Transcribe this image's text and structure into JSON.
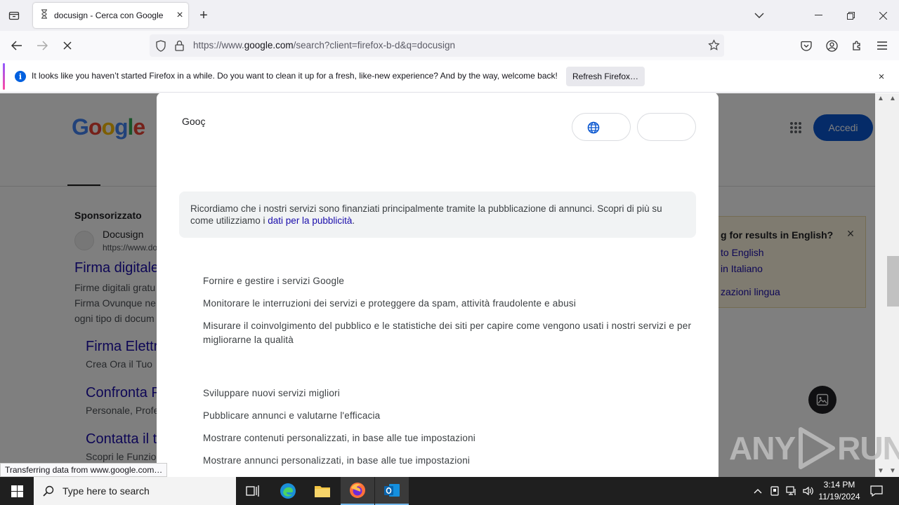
{
  "browser": {
    "tab_title": "docusign - Cerca con Google",
    "url_prefix": "https://www.",
    "url_domain": "google.com",
    "url_path": "/search?client=firefox-b-d&q=docusign"
  },
  "infobar": {
    "message": "It looks like you haven’t started Firefox in a while. Do you want to clean it up for a fresh, like-new experience? And by the way, welcome back!",
    "button": "Refresh Firefox…"
  },
  "google": {
    "signin": "Accedi",
    "sponsored": "Sponsorizzato",
    "ad_name": "Docusign",
    "ad_url": "https://www.do",
    "ad_title": "Firma digitale",
    "ad_desc": [
      "Firme digitali gratu",
      "Firma Ovunque ne",
      "ogni tipo di docum"
    ],
    "sitelinks": [
      {
        "title": "Firma Elettr",
        "desc": "Crea Ora il Tuo"
      },
      {
        "title": "Confronta P",
        "desc": "Personale, Profe"
      },
      {
        "title": "Contatta il t",
        "desc": "Scopri le Funzio"
      }
    ],
    "lang_card": {
      "question": "g for results in English?",
      "opt1": "to English",
      "opt2": "in Italiano",
      "opt3": "zazioni lingua"
    }
  },
  "consent": {
    "logo_text": "Gooç",
    "notice_text": "Ricordiamo che i nostri servizi sono finanziati principalmente tramite la pubblicazione di annunci. Scopri di più su come utilizziamo i ",
    "notice_link": "dati per la pubblicità",
    "notice_end": ".",
    "items": [
      "Fornire e gestire i servizi Google",
      "Monitorare le interruzioni dei servizi e proteggere da spam, attività fraudolente e abusi",
      "Misurare il coinvolgimento del pubblico e le statistiche dei siti per capire come vengono usati i nostri servizi e per migliorarne la qualità",
      "Sviluppare nuovi servizi migliori",
      "Pubblicare annunci e valutarne l'efficacia",
      "Mostrare contenuti personalizzati, in base alle tue impostazioni",
      "Mostrare annunci personalizzati, in base alle tue impostazioni"
    ]
  },
  "status_text": "Transferring data from www.google.com…",
  "watermark": {
    "left": "ANY",
    "right": "RUN"
  },
  "taskbar": {
    "search_placeholder": "Type here to search",
    "time": "3:14 PM",
    "date": "11/19/2024"
  },
  "colors": {
    "accent": "#0b57d0",
    "link": "#1a0dab",
    "firefox_blue": "#0060df"
  }
}
